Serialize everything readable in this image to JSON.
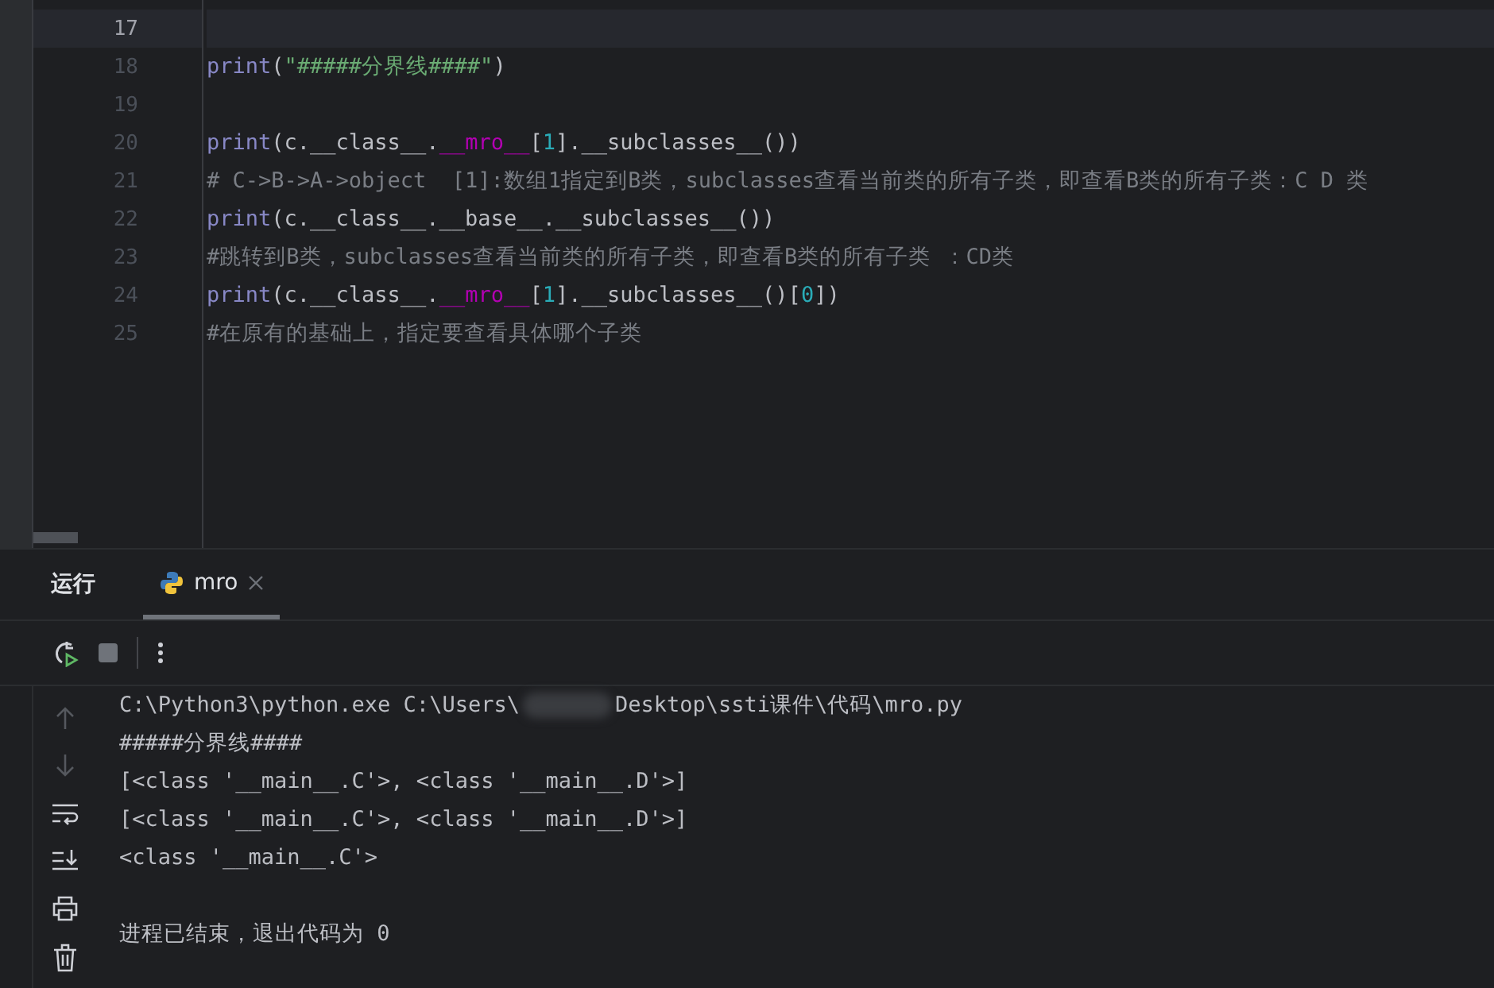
{
  "editor": {
    "lines": [
      {
        "number": "17",
        "current": true
      },
      {
        "number": "18",
        "current": false,
        "tokens": [
          {
            "kind": "builtin",
            "text": "print"
          },
          {
            "kind": "plain",
            "text": "("
          },
          {
            "kind": "string",
            "text": "\"#####分界线####\""
          },
          {
            "kind": "plain",
            "text": ")"
          }
        ]
      },
      {
        "number": "19",
        "current": false
      },
      {
        "number": "20",
        "current": false,
        "tokens": [
          {
            "kind": "builtin",
            "text": "print"
          },
          {
            "kind": "plain",
            "text": "(c.__class__."
          },
          {
            "kind": "special",
            "text": "__mro__"
          },
          {
            "kind": "plain",
            "text": "["
          },
          {
            "kind": "number",
            "text": "1"
          },
          {
            "kind": "plain",
            "text": "].__subclasses__())"
          }
        ]
      },
      {
        "number": "21",
        "current": false,
        "tokens": [
          {
            "kind": "comment",
            "text": "# C->B->A->object  [1]:数组1指定到B类，subclasses查看当前类的所有子类，即查看B类的所有子类：C D 类"
          }
        ]
      },
      {
        "number": "22",
        "current": false,
        "tokens": [
          {
            "kind": "builtin",
            "text": "print"
          },
          {
            "kind": "plain",
            "text": "(c.__class__.__base__.__subclasses__())"
          }
        ]
      },
      {
        "number": "23",
        "current": false,
        "tokens": [
          {
            "kind": "comment",
            "text": "#跳转到B类，subclasses查看当前类的所有子类，即查看B类的所有子类 ：CD类"
          }
        ]
      },
      {
        "number": "24",
        "current": false,
        "tokens": [
          {
            "kind": "builtin",
            "text": "print"
          },
          {
            "kind": "plain",
            "text": "(c.__class__."
          },
          {
            "kind": "special",
            "text": "__mro__"
          },
          {
            "kind": "plain",
            "text": "["
          },
          {
            "kind": "number",
            "text": "1"
          },
          {
            "kind": "plain",
            "text": "].__subclasses__()["
          },
          {
            "kind": "number",
            "text": "0"
          },
          {
            "kind": "plain",
            "text": "])"
          }
        ]
      },
      {
        "number": "25",
        "current": false,
        "tokens": [
          {
            "kind": "comment",
            "text": "#在原有的基础上，指定要查看具体哪个子类"
          }
        ]
      }
    ]
  },
  "run_panel": {
    "title": "运行",
    "tabs": [
      {
        "label": "mro",
        "selected": true
      }
    ],
    "console": [
      {
        "kind": "path",
        "parts": [
          "C:\\Python3\\python.exe C:\\Users\\",
          "Desktop\\ssti课件\\代码\\mro.py"
        ]
      },
      {
        "kind": "text",
        "text": "#####分界线####"
      },
      {
        "kind": "text",
        "text": "[<class '__main__.C'>, <class '__main__.D'>]"
      },
      {
        "kind": "text",
        "text": "[<class '__main__.C'>, <class '__main__.D'>]"
      },
      {
        "kind": "text",
        "text": "<class '__main__.C'>"
      },
      {
        "kind": "blank"
      },
      {
        "kind": "text",
        "text": "进程已结束，退出代码为 0"
      }
    ]
  }
}
